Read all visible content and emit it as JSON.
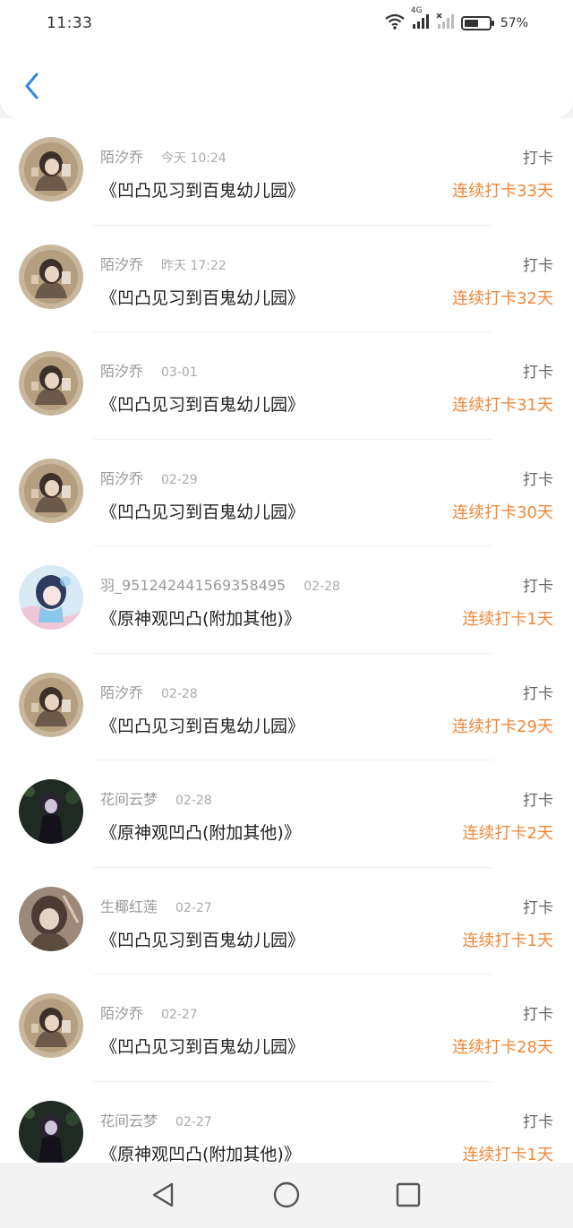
{
  "status_bar": {
    "time": "11:33",
    "network": "4G",
    "battery_text": "57%",
    "battery_level": 0.57
  },
  "header": {
    "back_icon": "chevron-left-icon",
    "accent": "#2f86e3"
  },
  "colors": {
    "streak": "#f0883a",
    "name": "#999999",
    "book": "#222222"
  },
  "records": [
    {
      "user": "陌汐乔",
      "time": "今天 10:24",
      "book": "《凹凸见习到百鬼幼儿园》",
      "action": "打卡",
      "streak": "连续打卡33天",
      "avatar": "avatar-girl-brown"
    },
    {
      "user": "陌汐乔",
      "time": "昨天 17:22",
      "book": "《凹凸见习到百鬼幼儿园》",
      "action": "打卡",
      "streak": "连续打卡32天",
      "avatar": "avatar-girl-brown"
    },
    {
      "user": "陌汐乔",
      "time": "03-01",
      "book": "《凹凸见习到百鬼幼儿园》",
      "action": "打卡",
      "streak": "连续打卡31天",
      "avatar": "avatar-girl-brown"
    },
    {
      "user": "陌汐乔",
      "time": "02-29",
      "book": "《凹凸见习到百鬼幼儿园》",
      "action": "打卡",
      "streak": "连续打卡30天",
      "avatar": "avatar-girl-brown"
    },
    {
      "user": "羽_9512424415693584​95",
      "time": "02-28",
      "book": "《原神观凹凸(附加其他)》",
      "action": "打卡",
      "streak": "连续打卡1天",
      "avatar": "avatar-girl-blue"
    },
    {
      "user": "陌汐乔",
      "time": "02-28",
      "book": "《凹凸见习到百鬼幼儿园》",
      "action": "打卡",
      "streak": "连续打卡29天",
      "avatar": "avatar-girl-brown"
    },
    {
      "user": "花间云梦",
      "time": "02-28",
      "book": "《原神观凹凸(附加其他)》",
      "action": "打卡",
      "streak": "连续打卡2天",
      "avatar": "avatar-girl-dark"
    },
    {
      "user": "生椰红莲",
      "time": "02-27",
      "book": "《凹凸见习到百鬼幼儿园》",
      "action": "打卡",
      "streak": "连续打卡1天",
      "avatar": "avatar-girl-sepia"
    },
    {
      "user": "陌汐乔",
      "time": "02-27",
      "book": "《凹凸见习到百鬼幼儿园》",
      "action": "打卡",
      "streak": "连续打卡28天",
      "avatar": "avatar-girl-brown"
    },
    {
      "user": "花间云梦",
      "time": "02-27",
      "book": "《原神观凹凸(附加其他)》",
      "action": "打卡",
      "streak": "连续打卡1天",
      "avatar": "avatar-girl-dark"
    }
  ],
  "nav": {
    "back": "triangle-back-icon",
    "home": "circle-home-icon",
    "recents": "square-recents-icon"
  }
}
